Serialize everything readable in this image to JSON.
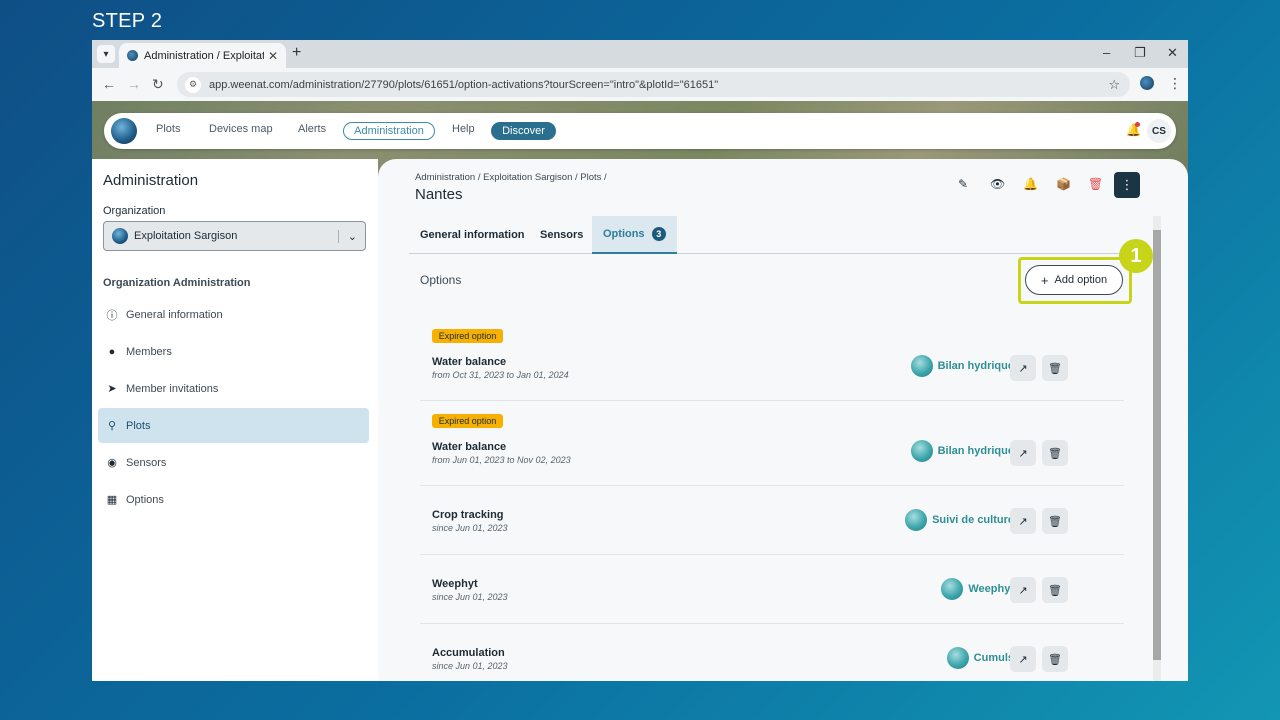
{
  "step_label": "STEP 2",
  "browser": {
    "tab_title": "Administration / Exploitation Sargison",
    "url": "app.weenat.com/administration/27790/plots/61651/option-activations?tourScreen=\"intro\"&plotId=\"61651\""
  },
  "topnav": {
    "items": [
      "Plots",
      "Devices map",
      "Alerts",
      "Administration",
      "Help",
      "Discover"
    ],
    "avatar_initials": "CS"
  },
  "sidebar": {
    "title": "Administration",
    "org_label": "Organization",
    "org_name": "Exploitation Sargison",
    "section_title": "Organization Administration",
    "items": [
      {
        "label": "General information",
        "icon": "info-icon"
      },
      {
        "label": "Members",
        "icon": "person-icon"
      },
      {
        "label": "Member invitations",
        "icon": "send-icon"
      },
      {
        "label": "Plots",
        "icon": "plot-pin-icon",
        "active": true
      },
      {
        "label": "Sensors",
        "icon": "sensor-icon"
      },
      {
        "label": "Options",
        "icon": "grid-add-icon"
      }
    ]
  },
  "main": {
    "breadcrumb": "Administration / Exploitation Sargison / Plots /",
    "title": "Nantes",
    "tabs": [
      {
        "label": "General information"
      },
      {
        "label": "Sensors"
      },
      {
        "label": "Options",
        "count": "3",
        "active": true
      }
    ],
    "options_heading": "Options",
    "add_option_label": "Add option",
    "step_marker": "1",
    "options": [
      {
        "badge": "Expired option",
        "name": "Water balance",
        "dates": "from Oct 31, 2023 to Jan 01, 2024",
        "brand": "Bilan hydrique"
      },
      {
        "badge": "Expired option",
        "name": "Water balance",
        "dates": "from Jun 01, 2023 to Nov 02, 2023",
        "brand": "Bilan hydrique"
      },
      {
        "badge": "",
        "name": "Crop tracking",
        "dates": "since Jun 01, 2023",
        "brand": "Suivi de culture"
      },
      {
        "badge": "",
        "name": "Weephyt",
        "dates": "since Jun 01, 2023",
        "brand": "Weephyt"
      },
      {
        "badge": "",
        "name": "Accumulation",
        "dates": "since Jun 01, 2023",
        "brand": "Cumuls"
      }
    ]
  },
  "colors": {
    "accent": "#2e7d9c",
    "highlight": "#c8d419",
    "expired_badge": "#f6b000",
    "discover_button": "#2b6f8f"
  }
}
